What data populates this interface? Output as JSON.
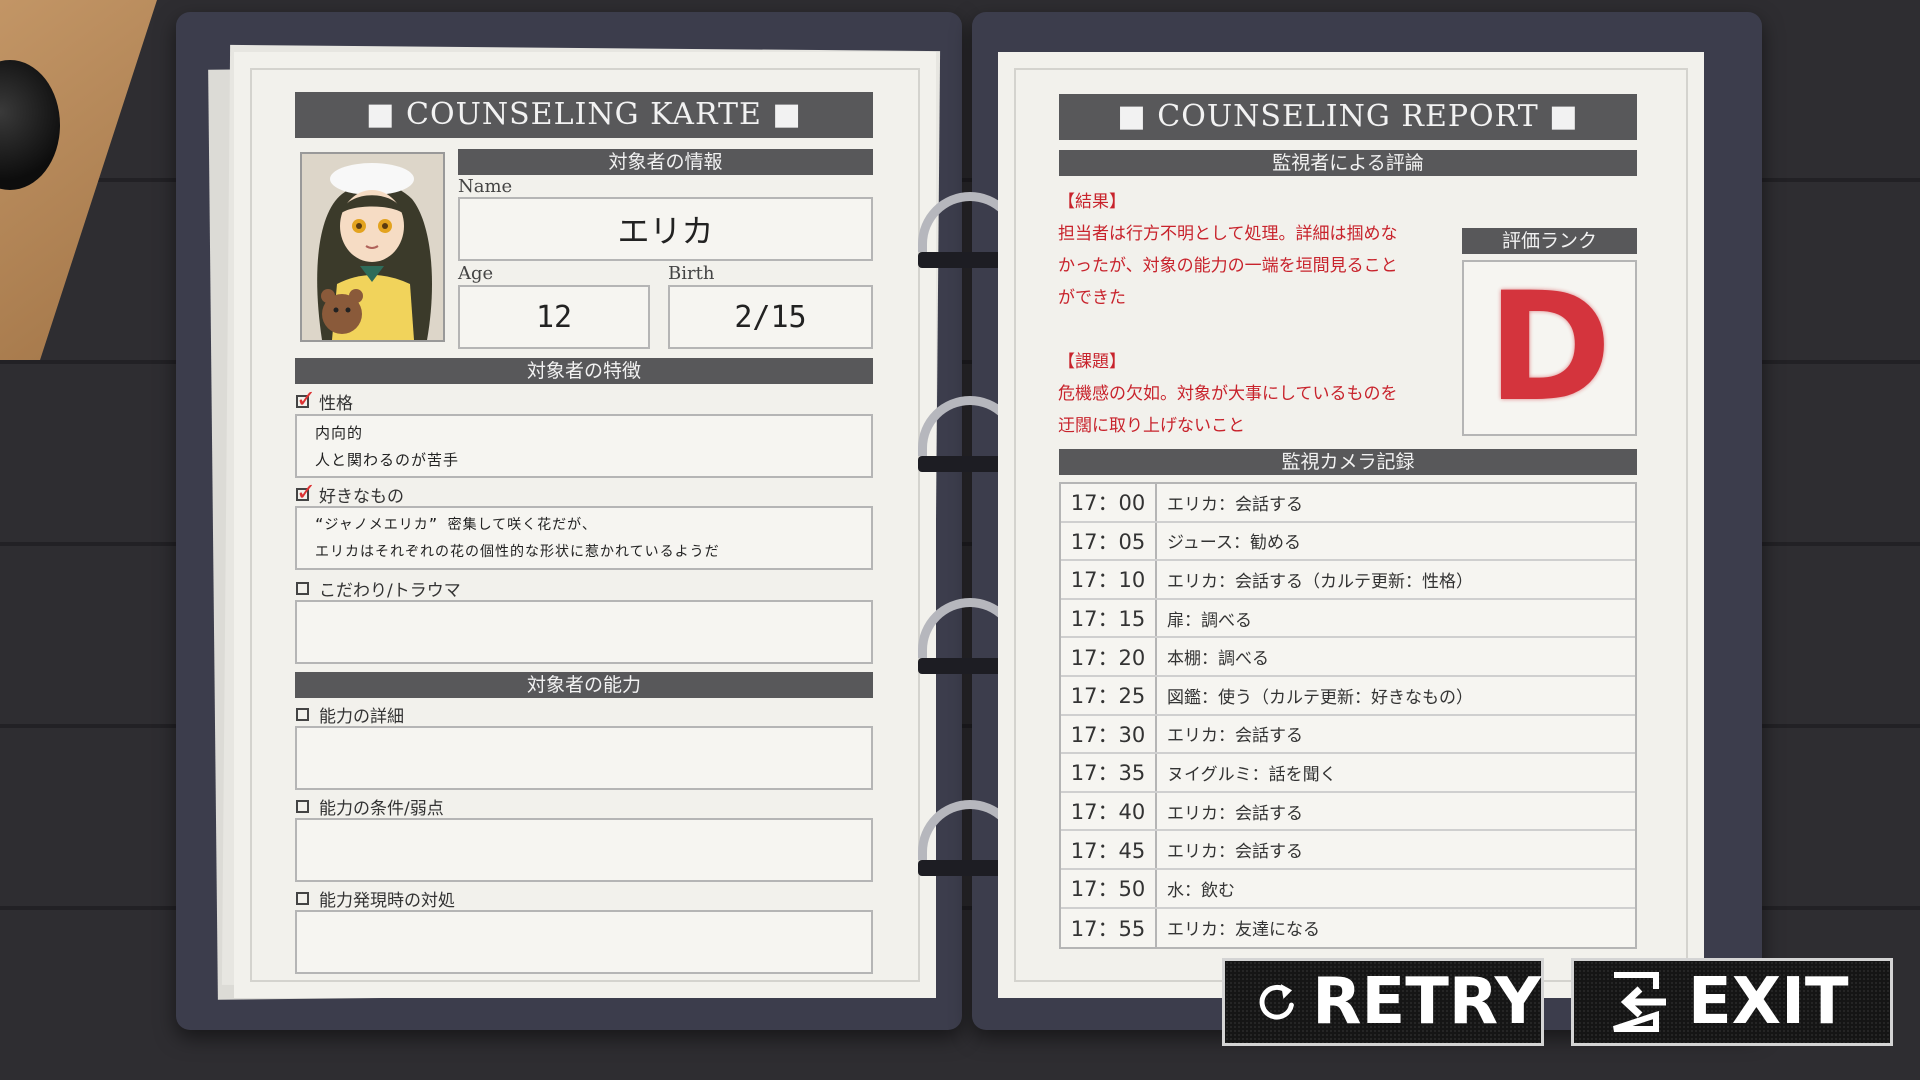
{
  "karte": {
    "title": "■ COUNSELING  KARTE ■",
    "info_header": "対象者の情報",
    "name_label": "Name",
    "name_value": "エリカ",
    "age_label": "Age",
    "age_value": "12",
    "birth_label": "Birth",
    "birth_value": "2/15",
    "traits_header": "対象者の特徴",
    "personality_label": "性格",
    "personality_lines": [
      "内向的",
      "人と関わるのが苦手"
    ],
    "likes_label": "好きなもの",
    "likes_lines": [
      "“ジャノメエリカ” 密集して咲く花だが、",
      "エリカはそれぞれの花の個性的な形状に惹かれているようだ"
    ],
    "trauma_label": "こだわり/トラウマ",
    "ability_header": "対象者の能力",
    "ability_detail_label": "能力の詳細",
    "ability_cond_label": "能力の条件/弱点",
    "ability_response_label": "能力発現時の対処"
  },
  "report": {
    "title": "■ COUNSELING  REPORT ■",
    "eval_header": "監視者による評論",
    "result_heading": "【結果】",
    "result_lines": [
      "担当者は行方不明として処理。詳細は掴めな",
      "かったが、対象の能力の一端を垣間見ること",
      "ができた"
    ],
    "issue_heading": "【課題】",
    "issue_lines": [
      "危機感の欠如。対象が大事にしているものを",
      "迂闊に取り上げないこと"
    ],
    "rank_header": "評価ランク",
    "rank_value": "D",
    "camera_header": "監視カメラ記録",
    "log": [
      {
        "time": "17：00",
        "action": "エリカ：会話する"
      },
      {
        "time": "17：05",
        "action": "ジュース：勧める"
      },
      {
        "time": "17：10",
        "action": "エリカ：会話する（カルテ更新：性格）"
      },
      {
        "time": "17：15",
        "action": "扉：調べる"
      },
      {
        "time": "17：20",
        "action": "本棚：調べる"
      },
      {
        "time": "17：25",
        "action": "図鑑：使う（カルテ更新：好きなもの）"
      },
      {
        "time": "17：30",
        "action": "エリカ：会話する"
      },
      {
        "time": "17：35",
        "action": "ヌイグルミ：話を聞く"
      },
      {
        "time": "17：40",
        "action": "エリカ：会話する"
      },
      {
        "time": "17：45",
        "action": "エリカ：会話する"
      },
      {
        "time": "17：50",
        "action": "水：飲む"
      },
      {
        "time": "17：55",
        "action": "エリカ：友達になる"
      }
    ]
  },
  "buttons": {
    "retry": "RETRY",
    "exit": "EXIT"
  },
  "colors": {
    "accent_red": "#c8232c",
    "binder": "#3c3d4c",
    "header_gray": "#58585a"
  },
  "icons": {
    "retry": "retry-icon",
    "exit": "exit-icon"
  }
}
